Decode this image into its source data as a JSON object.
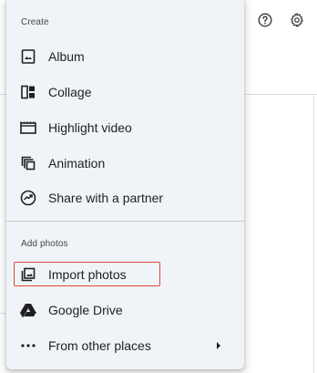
{
  "header": {
    "help_icon": "help-circle-icon",
    "settings_icon": "gear-icon"
  },
  "menu": {
    "create_label": "Create",
    "create_items": [
      {
        "label": "Album",
        "icon": "album-icon"
      },
      {
        "label": "Collage",
        "icon": "collage-icon"
      },
      {
        "label": "Highlight video",
        "icon": "movie-icon"
      },
      {
        "label": "Animation",
        "icon": "animation-icon"
      },
      {
        "label": "Share with a partner",
        "icon": "partner-sharing-icon"
      }
    ],
    "add_label": "Add photos",
    "add_items": [
      {
        "label": "Import photos",
        "icon": "import-photos-icon",
        "highlighted": true
      },
      {
        "label": "Google Drive",
        "icon": "google-drive-icon"
      },
      {
        "label": "From other places",
        "icon": "more-horiz-icon",
        "has_submenu": true
      }
    ]
  },
  "colors": {
    "menu_background": "#f0f4f9",
    "highlight_border": "#e0463e",
    "text": "#1f1f1f"
  }
}
